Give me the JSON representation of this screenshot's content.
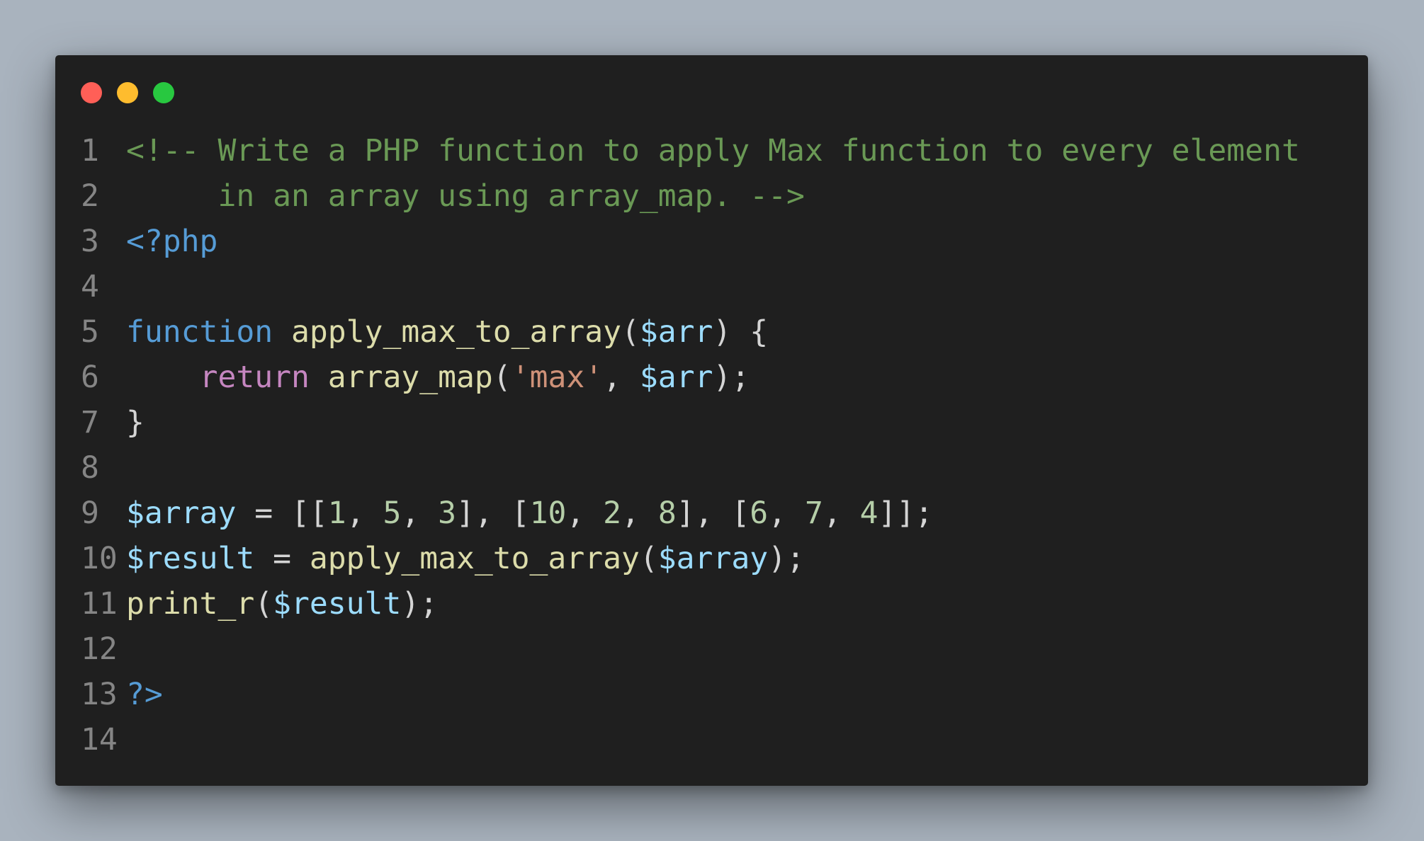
{
  "window": {
    "traffic_lights": [
      {
        "name": "close",
        "color": "#ff5f57"
      },
      {
        "name": "minimize",
        "color": "#febc2e"
      },
      {
        "name": "zoom",
        "color": "#28c840"
      }
    ]
  },
  "colors": {
    "comment": "#6a9955",
    "keyword": "#569cd6",
    "control": "#c586c0",
    "function": "#dcdcaa",
    "variable": "#9cdcfe",
    "string": "#ce9178",
    "number": "#b5cea8",
    "plain": "#d4d4d4"
  },
  "code_lines": [
    {
      "n": "1",
      "tokens": [
        {
          "t": "<!-- Write a PHP function to apply Max function to every element",
          "c": "comment"
        }
      ]
    },
    {
      "n": "2",
      "tokens": [
        {
          "t": "     in an array using array_map. -->",
          "c": "comment"
        }
      ]
    },
    {
      "n": "3",
      "tokens": [
        {
          "t": "<?php",
          "c": "keyword"
        }
      ]
    },
    {
      "n": "4",
      "tokens": []
    },
    {
      "n": "5",
      "tokens": [
        {
          "t": "function",
          "c": "keyword"
        },
        {
          "t": " ",
          "c": "plain"
        },
        {
          "t": "apply_max_to_array",
          "c": "function"
        },
        {
          "t": "(",
          "c": "plain"
        },
        {
          "t": "$arr",
          "c": "variable"
        },
        {
          "t": ") {",
          "c": "plain"
        }
      ]
    },
    {
      "n": "6",
      "tokens": [
        {
          "t": "    ",
          "c": "plain"
        },
        {
          "t": "return",
          "c": "control"
        },
        {
          "t": " ",
          "c": "plain"
        },
        {
          "t": "array_map",
          "c": "function"
        },
        {
          "t": "(",
          "c": "plain"
        },
        {
          "t": "'max'",
          "c": "string"
        },
        {
          "t": ", ",
          "c": "plain"
        },
        {
          "t": "$arr",
          "c": "variable"
        },
        {
          "t": ");",
          "c": "plain"
        }
      ]
    },
    {
      "n": "7",
      "tokens": [
        {
          "t": "}",
          "c": "plain"
        }
      ]
    },
    {
      "n": "8",
      "tokens": []
    },
    {
      "n": "9",
      "tokens": [
        {
          "t": "$array",
          "c": "variable"
        },
        {
          "t": " = [[",
          "c": "plain"
        },
        {
          "t": "1",
          "c": "number"
        },
        {
          "t": ", ",
          "c": "plain"
        },
        {
          "t": "5",
          "c": "number"
        },
        {
          "t": ", ",
          "c": "plain"
        },
        {
          "t": "3",
          "c": "number"
        },
        {
          "t": "], [",
          "c": "plain"
        },
        {
          "t": "10",
          "c": "number"
        },
        {
          "t": ", ",
          "c": "plain"
        },
        {
          "t": "2",
          "c": "number"
        },
        {
          "t": ", ",
          "c": "plain"
        },
        {
          "t": "8",
          "c": "number"
        },
        {
          "t": "], [",
          "c": "plain"
        },
        {
          "t": "6",
          "c": "number"
        },
        {
          "t": ", ",
          "c": "plain"
        },
        {
          "t": "7",
          "c": "number"
        },
        {
          "t": ", ",
          "c": "plain"
        },
        {
          "t": "4",
          "c": "number"
        },
        {
          "t": "]];",
          "c": "plain"
        }
      ]
    },
    {
      "n": "10",
      "tokens": [
        {
          "t": "$result",
          "c": "variable"
        },
        {
          "t": " = ",
          "c": "plain"
        },
        {
          "t": "apply_max_to_array",
          "c": "function"
        },
        {
          "t": "(",
          "c": "plain"
        },
        {
          "t": "$array",
          "c": "variable"
        },
        {
          "t": ");",
          "c": "plain"
        }
      ]
    },
    {
      "n": "11",
      "tokens": [
        {
          "t": "print_r",
          "c": "function"
        },
        {
          "t": "(",
          "c": "plain"
        },
        {
          "t": "$result",
          "c": "variable"
        },
        {
          "t": ");",
          "c": "plain"
        }
      ]
    },
    {
      "n": "12",
      "tokens": []
    },
    {
      "n": "13",
      "tokens": [
        {
          "t": "?>",
          "c": "keyword"
        }
      ]
    },
    {
      "n": "14",
      "tokens": []
    }
  ]
}
